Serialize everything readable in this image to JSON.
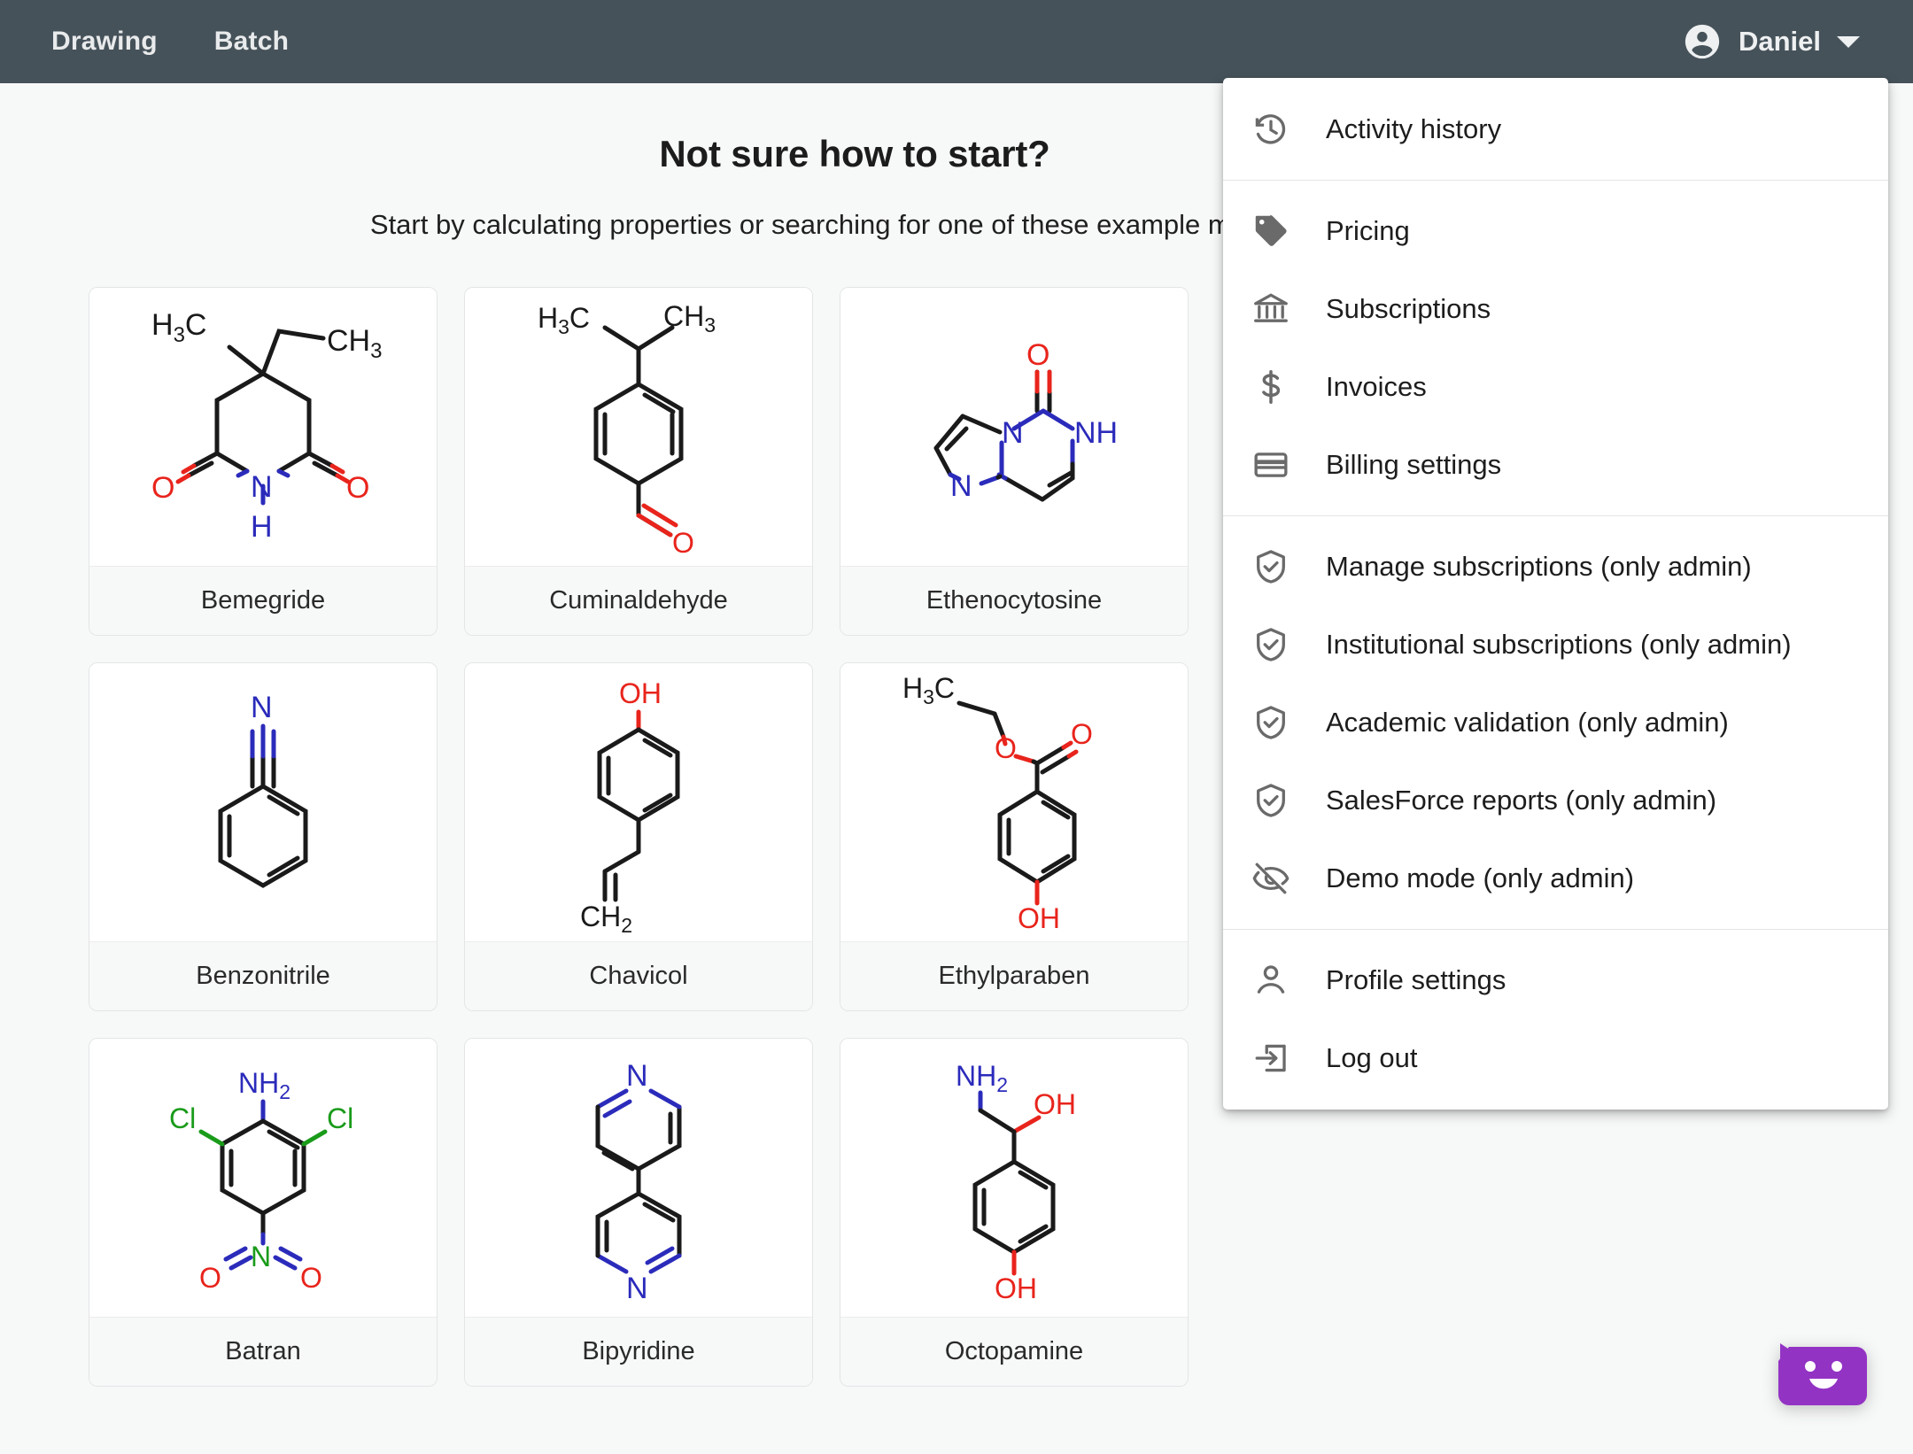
{
  "topbar": {
    "nav": [
      {
        "label": "Drawing"
      },
      {
        "label": "Batch"
      }
    ],
    "user": {
      "name": "Daniel",
      "avatar_icon": "account-circle-icon",
      "caret_icon": "chevron-down-icon"
    },
    "background_color": "#46525a"
  },
  "main": {
    "headline": "Not sure how to start?",
    "subhead": "Start by calculating properties or searching for one of these example molecules.",
    "molecules": [
      {
        "name": "Bemegride",
        "structure": "bemegride"
      },
      {
        "name": "Cuminaldehyde",
        "structure": "cuminaldehyde"
      },
      {
        "name": "Ethenocytosine",
        "structure": "ethenocytosine"
      },
      {
        "name": "Benzonitrile",
        "structure": "benzonitrile"
      },
      {
        "name": "Chavicol",
        "structure": "chavicol"
      },
      {
        "name": "Ethylparaben",
        "structure": "ethylparaben"
      },
      {
        "name": "Batran",
        "structure": "batran"
      },
      {
        "name": "Bipyridine",
        "structure": "bipyridine"
      },
      {
        "name": "Octopamine",
        "structure": "octopamine"
      }
    ],
    "atom_colors": {
      "carbon": "#1a1a1a",
      "nitrogen": "#2b2bbb",
      "oxygen": "#e8241c",
      "chlorine": "#1a9b1a"
    }
  },
  "user_menu": {
    "open": true,
    "groups": [
      {
        "items": [
          {
            "label": "Activity history",
            "icon": "history-icon"
          }
        ]
      },
      {
        "items": [
          {
            "label": "Pricing",
            "icon": "tag-icon"
          },
          {
            "label": "Subscriptions",
            "icon": "bank-icon"
          },
          {
            "label": "Invoices",
            "icon": "dollar-icon"
          },
          {
            "label": "Billing settings",
            "icon": "credit-card-icon"
          }
        ]
      },
      {
        "items": [
          {
            "label": "Manage subscriptions (only admin)",
            "icon": "shield-check-icon"
          },
          {
            "label": "Institutional subscriptions (only admin)",
            "icon": "shield-check-icon"
          },
          {
            "label": "Academic validation (only admin)",
            "icon": "shield-check-icon"
          },
          {
            "label": "SalesForce reports (only admin)",
            "icon": "shield-check-icon"
          },
          {
            "label": "Demo mode (only admin)",
            "icon": "eye-off-icon"
          }
        ]
      },
      {
        "items": [
          {
            "label": "Profile settings",
            "icon": "person-icon"
          },
          {
            "label": "Log out",
            "icon": "logout-icon"
          }
        ]
      }
    ]
  },
  "chat_widget": {
    "icon": "chat-smiley-icon",
    "color": "#9333c4"
  }
}
